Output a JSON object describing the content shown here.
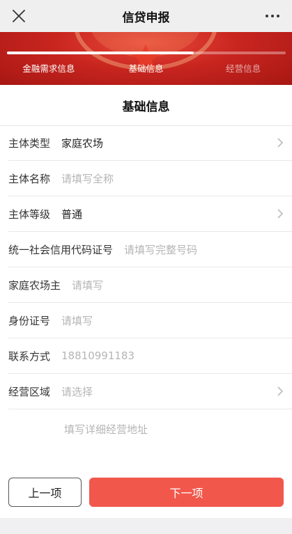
{
  "header": {
    "title": "信贷申报",
    "close_icon": "close-icon",
    "more_icon": "more-icon"
  },
  "progress": {
    "steps": [
      {
        "label": "金融需求信息",
        "active": true
      },
      {
        "label": "基础信息",
        "active": true
      },
      {
        "label": "经营信息",
        "active": false
      }
    ],
    "fraction": 0.67
  },
  "form": {
    "section_title": "基础信息",
    "fields": [
      {
        "label": "主体类型",
        "value": "家庭农场",
        "placeholder": "",
        "chevron": true
      },
      {
        "label": "主体名称",
        "value": "",
        "placeholder": "请填写全称",
        "chevron": false
      },
      {
        "label": "主体等级",
        "value": "普通",
        "placeholder": "",
        "chevron": true
      },
      {
        "label": "统一社会信用代码证号",
        "value": "",
        "placeholder": "请填写完整号码",
        "chevron": false
      },
      {
        "label": "家庭农场主",
        "value": "",
        "placeholder": "请填写",
        "chevron": false
      },
      {
        "label": "身份证号",
        "value": "",
        "placeholder": "请填写",
        "chevron": false
      },
      {
        "label": "联系方式",
        "value": "",
        "placeholder": "18810991183",
        "chevron": false
      },
      {
        "label": "经营区域",
        "value": "",
        "placeholder": "请选择",
        "chevron": true
      }
    ],
    "address_placeholder": "填写详细经营地址"
  },
  "buttons": {
    "prev_label": "上一项",
    "next_label": "下一项"
  },
  "colors": {
    "accent": "#f2574b",
    "banner": "#c8251f",
    "placeholder": "#b5b5b5"
  }
}
